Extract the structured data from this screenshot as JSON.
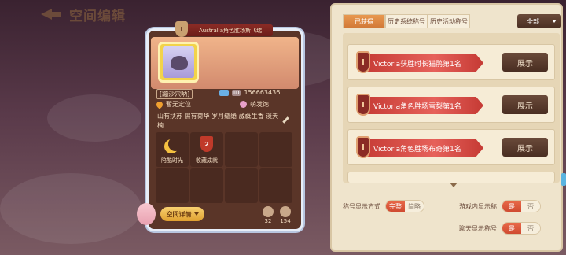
{
  "header": {
    "title": "空间编辑"
  },
  "card": {
    "banner_text": "Australia角色胜场斯飞瑞",
    "banner_rank": "I",
    "nickname": "[蹦沙穴呐]",
    "id_label": "ID",
    "id_value": "156663436",
    "location": "暂无定位",
    "pet": "萌发饱",
    "bio": "山有扶苏 隰有荷华 岁月缱绻 葳蕤生香 淡天楠",
    "slots": [
      {
        "label": "陪酷时光",
        "icon": "moon-icon"
      },
      {
        "label": "收藏成就",
        "icon": "badge-icon",
        "badge_num": "2"
      },
      {
        "label": ""
      },
      {
        "label": ""
      },
      {
        "label": ""
      },
      {
        "label": ""
      },
      {
        "label": ""
      },
      {
        "label": ""
      }
    ],
    "detail_button": "空间详情",
    "stats": [
      {
        "value": "32"
      },
      {
        "value": "154"
      }
    ]
  },
  "panel": {
    "tabs": [
      {
        "label": "已获得",
        "active": true
      },
      {
        "label": "历史系统称号",
        "active": false
      },
      {
        "label": "历史活动称号",
        "active": false
      }
    ],
    "filter": "全部",
    "titles": [
      {
        "text": "Victoria获胜时长猫鹃第1名",
        "rank": "I",
        "button": "展示"
      },
      {
        "text": "Victoria角色胜场雪梨第1名",
        "rank": "I",
        "button": "展示"
      },
      {
        "text": "Victoria角色胜场布奇第1名",
        "rank": "I",
        "button": "展示"
      }
    ],
    "settings": {
      "display_mode_label": "称号显示方式",
      "display_mode_options": [
        "完整",
        "简略"
      ],
      "display_mode_selected": "完整",
      "in_game_label": "游戏内显示称",
      "in_game_options": [
        "是",
        "否"
      ],
      "in_game_selected": "是",
      "chat_label": "聊天显示称号",
      "chat_options": [
        "是",
        "否"
      ],
      "chat_selected": "是"
    }
  }
}
